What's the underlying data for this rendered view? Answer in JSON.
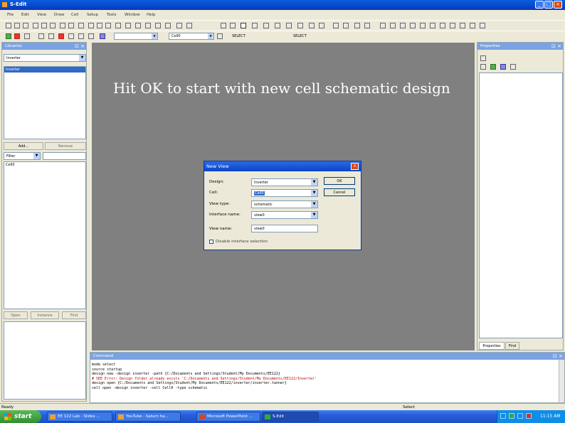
{
  "window": {
    "title": "S-Edit"
  },
  "menu": [
    "File",
    "Edit",
    "View",
    "Draw",
    "Cell",
    "Setup",
    "Tools",
    "Window",
    "Help"
  ],
  "toolbar": {
    "combo_cell": "Cell0",
    "select_label_1": "SELECT",
    "select_label_2": "SELECT"
  },
  "libraries": {
    "title": "Libraries",
    "library_combo": "Inverter",
    "cells": [
      "Inverter"
    ],
    "add_button": "Add...",
    "remove_button": "Remove",
    "filter_combo": "Filter",
    "filter_items": [
      "Cell0"
    ],
    "open_button": "Open",
    "instance_button": "Instance",
    "find_button": "Find"
  },
  "slide_caption": "Hit OK to start with new cell schematic design",
  "dialog": {
    "title": "New View",
    "fields": [
      {
        "label": "Design:",
        "value": "Inverter"
      },
      {
        "label": "Cell:",
        "value": "Cell0"
      },
      {
        "label": "View type:",
        "value": "schematic"
      },
      {
        "label": "Interface name:",
        "value": "view0"
      },
      {
        "label": "View name:",
        "value": "view0"
      }
    ],
    "checkbox_label": "Disable interface selection",
    "ok_button": "OK",
    "cancel_button": "Cancel"
  },
  "properties": {
    "title": "Properties",
    "tab_properties": "Properties",
    "tab_find": "Find"
  },
  "command": {
    "title": "Command",
    "lines": [
      "mode select",
      "source startup",
      "design new -design inverter -path {C:/Documents and Settings/Student/My Documents/EE122}",
      "# SEE Error: Design folder already exists 'C:/Documents and Settings/Student/My Documents/EE122/Inverter'",
      "design open {C:/Documents and Settings/Student/My Documents/EE122/inverter/inverter.tanner}",
      "cell open -design inverter -cell Cell0 -type schematic"
    ]
  },
  "status": {
    "left": "Ready",
    "center": "Select"
  },
  "taskbar": {
    "start": "start",
    "tasks": [
      "EE 122 Lab - Slides ...",
      "YouTube - Saturn ha...",
      "Microsoft PowerPoint ...",
      "S-Edit"
    ],
    "clock": "11:15 AM"
  },
  "colors": {
    "canvas": "#808080",
    "titlebar": "#0a5ee0",
    "panel_header": "#7aa2e4",
    "error_text": "#c00000"
  }
}
